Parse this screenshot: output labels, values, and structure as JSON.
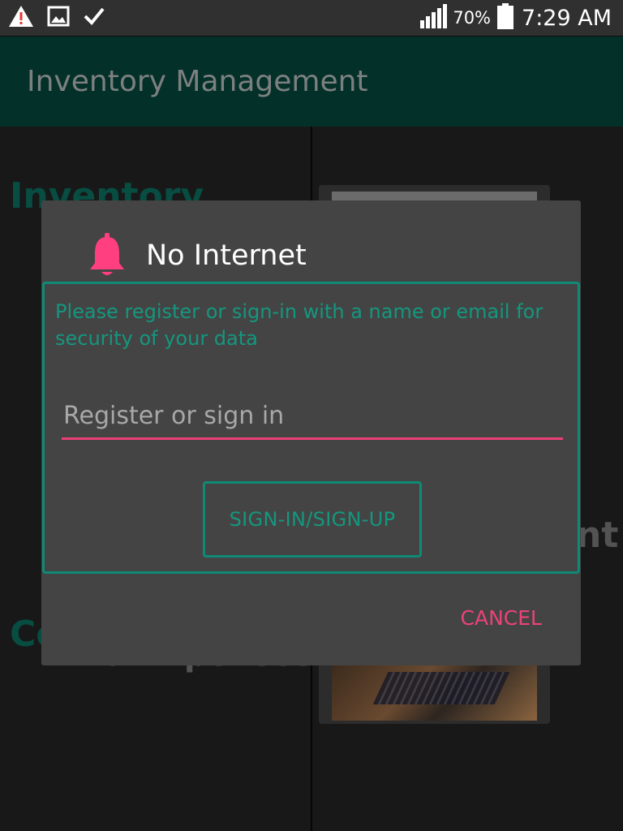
{
  "status_bar": {
    "icons": [
      "warning-icon",
      "image-icon",
      "check-icon",
      "signal-icon",
      "battery-icon"
    ],
    "battery_percent": "70%",
    "time": "7:29 AM"
  },
  "app_bar": {
    "title": "Inventory Management"
  },
  "background": {
    "text_1": "Inventory",
    "text_2": "Co",
    "text_3": "& Expenses",
    "text_4": "nt"
  },
  "dialog": {
    "icon": "bell-icon",
    "title": "No Internet",
    "message": "Please register or sign-in with a name or email for security of your data",
    "input": {
      "value": "",
      "placeholder": "Register or sign in"
    },
    "primary_button": "SIGN-IN/SIGN-UP",
    "cancel_button": "CANCEL"
  },
  "colors": {
    "accent_teal": "#0f8a76",
    "accent_pink": "#ea3f76",
    "app_bar_bg": "#04302a",
    "dialog_bg": "#444444"
  }
}
